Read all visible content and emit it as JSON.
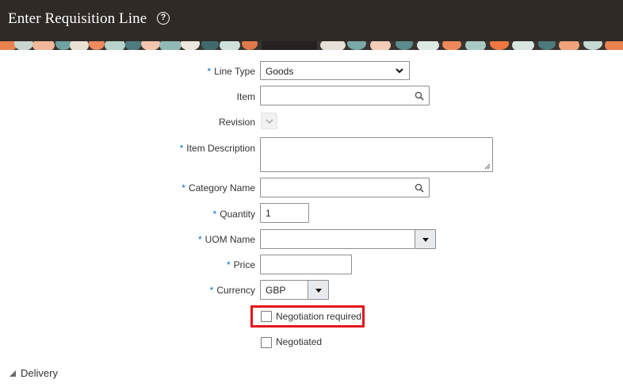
{
  "header": {
    "title": "Enter Requisition Line",
    "help_glyph": "?"
  },
  "form": {
    "required_marker": "*",
    "line_type": {
      "label": "Line Type",
      "value": "Goods"
    },
    "item": {
      "label": "Item",
      "value": ""
    },
    "revision": {
      "label": "Revision"
    },
    "item_description": {
      "label": "Item Description",
      "value": ""
    },
    "category_name": {
      "label": "Category Name",
      "value": ""
    },
    "quantity": {
      "label": "Quantity",
      "value": "1"
    },
    "uom_name": {
      "label": "UOM Name",
      "value": ""
    },
    "price": {
      "label": "Price",
      "value": ""
    },
    "currency": {
      "label": "Currency",
      "value": "GBP"
    },
    "negotiation_required": {
      "label": "Negotiation required",
      "checked": false
    },
    "negotiated": {
      "label": "Negotiated",
      "checked": false
    }
  },
  "delivery": {
    "label": "Delivery"
  },
  "colors": {
    "header_bg": "#2f2a26",
    "required_asterisk": "#0572ce",
    "highlight_border": "#e5141b"
  },
  "icons": [
    "help-icon",
    "chevron-down-icon",
    "search-icon",
    "dropdown-arrow-icon",
    "resize-grip-icon",
    "disclosure-triangle-icon"
  ]
}
